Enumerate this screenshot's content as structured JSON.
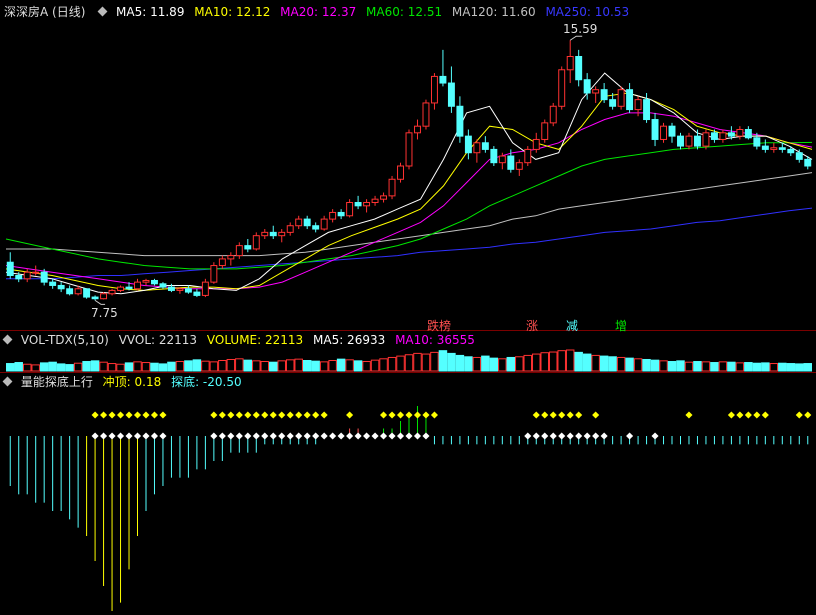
{
  "main_header": {
    "title": "深深房A (日线)",
    "ma5": "MA5: 11.89",
    "ma10": "MA10: 12.12",
    "ma20": "MA20: 12.37",
    "ma60": "MA60: 12.51",
    "ma120": "MA120: 11.60",
    "ma250": "MA250: 10.53"
  },
  "vol_header": {
    "title": "VOL-TDX(5,10)",
    "vvol": "VVOL: 22113",
    "volume": "VOLUME: 22113",
    "ma5": "MA5: 26933",
    "ma10": "MA10: 36555"
  },
  "ind_header": {
    "title": "量能探底上行",
    "chongding": "冲顶: 0.18",
    "tandi": "探底: -20.50"
  },
  "annotations": {
    "high": "15.59",
    "low": "7.75",
    "tag1": "跌榜",
    "tag2": "涨",
    "tag3": "减",
    "tag4": "增"
  },
  "colors": {
    "up": "#ff3232",
    "down": "#54ffff",
    "ma5": "#ffffff",
    "ma10": "#ffff00",
    "ma20": "#ff00ff",
    "ma60": "#00e600",
    "ma120": "#c0c0c0",
    "ma250": "#3030ff"
  },
  "chart_data": [
    {
      "type": "candlestick",
      "title": "深深房A (日线)",
      "ylim": [
        7.4,
        16.2
      ],
      "annotations": {
        "max": 15.59,
        "min": 7.75
      },
      "candles": [
        [
          8.9,
          9.2,
          8.4,
          8.5
        ],
        [
          8.5,
          8.6,
          8.3,
          8.4
        ],
        [
          8.4,
          8.7,
          8.3,
          8.6
        ],
        [
          8.6,
          8.8,
          8.5,
          8.6
        ],
        [
          8.6,
          8.7,
          8.2,
          8.3
        ],
        [
          8.3,
          8.4,
          8.1,
          8.2
        ],
        [
          8.2,
          8.3,
          8.0,
          8.1
        ],
        [
          8.1,
          8.2,
          7.9,
          7.95
        ],
        [
          7.95,
          8.2,
          7.9,
          8.1
        ],
        [
          8.1,
          8.1,
          7.8,
          7.85
        ],
        [
          7.85,
          7.9,
          7.75,
          7.8
        ],
        [
          7.8,
          8.0,
          7.78,
          7.95
        ],
        [
          7.95,
          8.1,
          7.9,
          8.05
        ],
        [
          8.05,
          8.2,
          8.0,
          8.15
        ],
        [
          8.15,
          8.3,
          8.05,
          8.1
        ],
        [
          8.1,
          8.4,
          8.05,
          8.3
        ],
        [
          8.3,
          8.4,
          8.2,
          8.35
        ],
        [
          8.35,
          8.4,
          8.2,
          8.25
        ],
        [
          8.25,
          8.3,
          8.1,
          8.15
        ],
        [
          8.15,
          8.25,
          8.0,
          8.05
        ],
        [
          8.05,
          8.15,
          7.95,
          8.1
        ],
        [
          8.1,
          8.2,
          7.95,
          8.0
        ],
        [
          8.0,
          8.1,
          7.85,
          7.9
        ],
        [
          7.9,
          8.4,
          7.85,
          8.3
        ],
        [
          8.3,
          8.9,
          8.25,
          8.8
        ],
        [
          8.8,
          9.1,
          8.7,
          9.0
        ],
        [
          9.0,
          9.2,
          8.8,
          9.1
        ],
        [
          9.1,
          9.5,
          9.0,
          9.4
        ],
        [
          9.4,
          9.6,
          9.2,
          9.3
        ],
        [
          9.3,
          9.8,
          9.25,
          9.7
        ],
        [
          9.7,
          9.9,
          9.6,
          9.8
        ],
        [
          9.8,
          10.0,
          9.6,
          9.7
        ],
        [
          9.7,
          9.9,
          9.5,
          9.8
        ],
        [
          9.8,
          10.1,
          9.7,
          10.0
        ],
        [
          10.0,
          10.3,
          9.9,
          10.2
        ],
        [
          10.2,
          10.3,
          9.9,
          10.0
        ],
        [
          10.0,
          10.1,
          9.8,
          9.9
        ],
        [
          9.9,
          10.3,
          9.85,
          10.2
        ],
        [
          10.2,
          10.5,
          10.1,
          10.4
        ],
        [
          10.4,
          10.5,
          10.2,
          10.3
        ],
        [
          10.3,
          10.8,
          10.25,
          10.7
        ],
        [
          10.7,
          10.9,
          10.5,
          10.6
        ],
        [
          10.6,
          10.8,
          10.4,
          10.7
        ],
        [
          10.7,
          10.9,
          10.6,
          10.8
        ],
        [
          10.8,
          11.0,
          10.7,
          10.9
        ],
        [
          10.9,
          11.5,
          10.8,
          11.4
        ],
        [
          11.4,
          11.9,
          11.3,
          11.8
        ],
        [
          11.8,
          12.9,
          11.7,
          12.8
        ],
        [
          12.8,
          13.2,
          12.6,
          13.0
        ],
        [
          13.0,
          13.8,
          12.9,
          13.7
        ],
        [
          13.7,
          14.6,
          13.5,
          14.5
        ],
        [
          14.5,
          15.3,
          14.2,
          14.3
        ],
        [
          14.3,
          14.8,
          13.4,
          13.6
        ],
        [
          13.6,
          13.9,
          12.5,
          12.7
        ],
        [
          12.7,
          12.9,
          12.0,
          12.2
        ],
        [
          12.2,
          12.6,
          11.9,
          12.5
        ],
        [
          12.5,
          12.7,
          12.2,
          12.3
        ],
        [
          12.3,
          12.4,
          11.8,
          11.9
        ],
        [
          11.9,
          12.2,
          11.7,
          12.1
        ],
        [
          12.1,
          12.3,
          11.6,
          11.7
        ],
        [
          11.7,
          12.0,
          11.5,
          11.9
        ],
        [
          11.9,
          12.4,
          11.8,
          12.3
        ],
        [
          12.3,
          12.8,
          12.2,
          12.6
        ],
        [
          12.6,
          13.2,
          12.5,
          13.1
        ],
        [
          13.1,
          13.7,
          13.0,
          13.6
        ],
        [
          13.6,
          14.8,
          13.5,
          14.7
        ],
        [
          14.7,
          15.59,
          14.3,
          15.1
        ],
        [
          15.1,
          15.3,
          14.2,
          14.4
        ],
        [
          14.4,
          14.6,
          13.8,
          14.0
        ],
        [
          14.0,
          14.2,
          13.7,
          14.1
        ],
        [
          14.1,
          14.3,
          13.7,
          13.8
        ],
        [
          13.8,
          14.0,
          13.5,
          13.6
        ],
        [
          13.6,
          14.2,
          13.5,
          14.1
        ],
        [
          14.1,
          14.3,
          13.4,
          13.5
        ],
        [
          13.5,
          13.9,
          13.3,
          13.8
        ],
        [
          13.8,
          14.0,
          13.1,
          13.2
        ],
        [
          13.2,
          13.4,
          12.4,
          12.6
        ],
        [
          12.6,
          13.1,
          12.5,
          13.0
        ],
        [
          13.0,
          13.1,
          12.5,
          12.7
        ],
        [
          12.7,
          12.8,
          12.3,
          12.4
        ],
        [
          12.4,
          12.8,
          12.3,
          12.7
        ],
        [
          12.7,
          12.9,
          12.3,
          12.4
        ],
        [
          12.4,
          12.9,
          12.3,
          12.8
        ],
        [
          12.8,
          12.9,
          12.5,
          12.6
        ],
        [
          12.6,
          12.9,
          12.5,
          12.8
        ],
        [
          12.8,
          13.0,
          12.6,
          12.7
        ],
        [
          12.7,
          13.0,
          12.6,
          12.9
        ],
        [
          12.9,
          13.0,
          12.6,
          12.65
        ],
        [
          12.65,
          12.8,
          12.3,
          12.4
        ],
        [
          12.4,
          12.6,
          12.2,
          12.3
        ],
        [
          12.3,
          12.5,
          12.2,
          12.35
        ],
        [
          12.35,
          12.5,
          12.2,
          12.3
        ],
        [
          12.3,
          12.4,
          12.1,
          12.2
        ],
        [
          12.2,
          12.3,
          11.9,
          12.0
        ],
        [
          12.0,
          12.1,
          11.7,
          11.8
        ]
      ],
      "ma": {
        "MA5": [
          8.6,
          8.5,
          8.4,
          8.2,
          8.0,
          7.95,
          8.05,
          8.2,
          8.2,
          8.1,
          8.05,
          8.4,
          9.0,
          9.4,
          9.8,
          10.0,
          10.2,
          10.5,
          10.8,
          12.0,
          13.4,
          13.6,
          12.5,
          12.0,
          12.2,
          13.8,
          14.6,
          14.0,
          13.8,
          13.4,
          12.8,
          12.6,
          12.7,
          12.7,
          12.4,
          12.0
        ],
        "MA10": [
          8.7,
          8.6,
          8.5,
          8.35,
          8.2,
          8.1,
          8.05,
          8.1,
          8.15,
          8.15,
          8.1,
          8.2,
          8.6,
          9.0,
          9.4,
          9.7,
          9.95,
          10.2,
          10.5,
          11.2,
          12.2,
          13.0,
          12.9,
          12.5,
          12.3,
          13.0,
          13.9,
          14.0,
          13.8,
          13.5,
          13.0,
          12.8,
          12.7,
          12.7,
          12.5,
          12.3
        ],
        "MA20": [
          8.8,
          8.7,
          8.6,
          8.5,
          8.4,
          8.3,
          8.2,
          8.15,
          8.1,
          8.1,
          8.1,
          8.15,
          8.3,
          8.6,
          8.9,
          9.2,
          9.5,
          9.8,
          10.1,
          10.6,
          11.3,
          12.0,
          12.2,
          12.3,
          12.5,
          12.9,
          13.2,
          13.4,
          13.4,
          13.3,
          13.1,
          12.9,
          12.8,
          12.7,
          12.5,
          12.37
        ],
        "MA60": [
          9.6,
          9.45,
          9.3,
          9.15,
          9.0,
          8.9,
          8.8,
          8.75,
          8.7,
          8.7,
          8.7,
          8.75,
          8.8,
          8.9,
          9.0,
          9.1,
          9.25,
          9.4,
          9.6,
          9.9,
          10.2,
          10.6,
          10.9,
          11.2,
          11.5,
          11.8,
          12.0,
          12.1,
          12.2,
          12.3,
          12.35,
          12.4,
          12.45,
          12.5,
          12.5,
          12.51
        ],
        "MA120": [
          9.3,
          9.3,
          9.3,
          9.25,
          9.2,
          9.15,
          9.1,
          9.1,
          9.1,
          9.1,
          9.1,
          9.1,
          9.15,
          9.2,
          9.3,
          9.4,
          9.5,
          9.6,
          9.7,
          9.8,
          9.9,
          10.0,
          10.2,
          10.3,
          10.5,
          10.6,
          10.7,
          10.8,
          10.9,
          11.0,
          11.1,
          11.2,
          11.3,
          11.4,
          11.5,
          11.6
        ],
        "MA250": [
          8.4,
          8.4,
          8.4,
          8.45,
          8.5,
          8.5,
          8.55,
          8.6,
          8.65,
          8.7,
          8.75,
          8.8,
          8.85,
          8.9,
          8.95,
          9.0,
          9.05,
          9.1,
          9.2,
          9.25,
          9.3,
          9.35,
          9.45,
          9.5,
          9.6,
          9.7,
          9.8,
          9.85,
          9.9,
          10.0,
          10.1,
          10.15,
          10.25,
          10.35,
          10.45,
          10.53
        ]
      }
    },
    {
      "type": "bar",
      "title": "VOL-TDX(5,10)",
      "values": [
        22,
        25,
        20,
        18,
        24,
        26,
        21,
        19,
        23,
        28,
        30,
        26,
        22,
        20,
        24,
        27,
        25,
        23,
        21,
        26,
        28,
        30,
        33,
        29,
        27,
        31,
        34,
        36,
        32,
        30,
        28,
        26,
        30,
        33,
        35,
        31,
        29,
        27,
        31,
        35,
        33,
        30,
        28,
        32,
        36,
        40,
        44,
        48,
        52,
        50,
        55,
        60,
        52,
        46,
        42,
        40,
        44,
        38,
        36,
        40,
        42,
        46,
        50,
        54,
        56,
        60,
        62,
        55,
        50,
        46,
        44,
        42,
        40,
        38,
        36,
        34,
        32,
        30,
        28,
        30,
        26,
        28,
        27,
        25,
        27,
        26,
        24,
        25,
        23,
        24,
        22,
        23,
        22,
        21,
        22
      ],
      "up": [
        false,
        false,
        true,
        true,
        false,
        false,
        false,
        false,
        true,
        false,
        false,
        true,
        true,
        true,
        false,
        true,
        true,
        false,
        false,
        false,
        true,
        false,
        false,
        true,
        true,
        true,
        true,
        true,
        false,
        true,
        true,
        false,
        true,
        true,
        true,
        false,
        false,
        true,
        true,
        false,
        true,
        false,
        true,
        true,
        true,
        true,
        true,
        true,
        true,
        true,
        true,
        false,
        false,
        false,
        false,
        true,
        false,
        false,
        true,
        false,
        true,
        true,
        true,
        true,
        true,
        true,
        true,
        false,
        false,
        true,
        false,
        false,
        true,
        false,
        true,
        false,
        false,
        true,
        false,
        false,
        true,
        false,
        true,
        false,
        true,
        false,
        true,
        false,
        false,
        false,
        true,
        false,
        false,
        false,
        false
      ]
    },
    {
      "type": "bar",
      "title": "量能探底上行",
      "values": [
        -6,
        -7,
        -7,
        -8,
        -8,
        -9,
        -9,
        -10,
        -11,
        -12,
        -15,
        -18,
        -21,
        -20,
        -16,
        -12,
        -9,
        -7,
        -6,
        -5,
        -5,
        -5,
        -4,
        -4,
        -3,
        -3,
        -2,
        -2,
        -2,
        -2,
        -1,
        -1,
        -1,
        -1,
        -1,
        -1,
        -1,
        0,
        0,
        0,
        1,
        1,
        0,
        0,
        1,
        1,
        2,
        3,
        4,
        3,
        -1,
        -1,
        -1,
        -1,
        -1,
        -1,
        -1,
        -1,
        -1,
        -1,
        -1,
        -1,
        -1,
        -1,
        -1,
        -1,
        -1,
        -1,
        -1,
        -1,
        -1,
        -1,
        -1,
        -1,
        -1,
        -1,
        -1,
        -1,
        -1,
        -1,
        -1,
        -1,
        -1,
        -1,
        -1,
        -1,
        -1,
        -1,
        -1,
        -1,
        -1,
        -1,
        -1,
        -1,
        -1
      ]
    }
  ]
}
